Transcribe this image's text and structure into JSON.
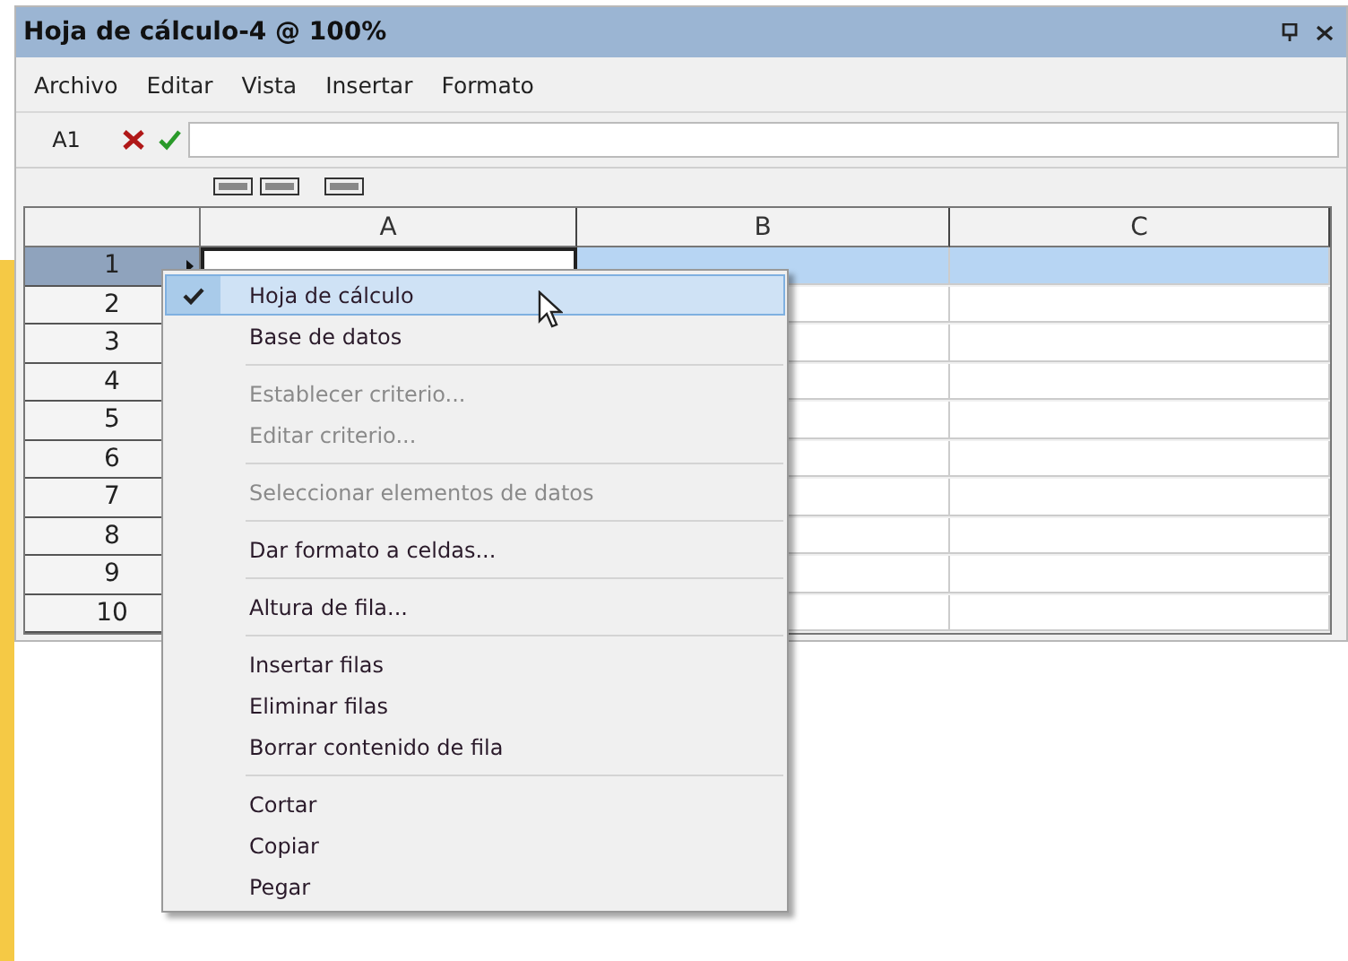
{
  "window": {
    "title": "Hoja de cálculo-4 @ 100%",
    "controls": [
      {
        "kind": "pin"
      },
      {
        "kind": "close"
      }
    ]
  },
  "menu_bar": [
    "Archivo",
    "Editar",
    "Vista",
    "Insertar",
    "Formato"
  ],
  "formula_bar": {
    "cell_ref": "A1"
  },
  "grid": {
    "columns": [
      "A",
      "B",
      "C"
    ],
    "rows": [
      {
        "label": "1",
        "selected": true
      },
      {
        "label": "2",
        "selected": false
      },
      {
        "label": "3",
        "selected": false
      },
      {
        "label": "4",
        "selected": false
      },
      {
        "label": "5",
        "selected": false
      },
      {
        "label": "6",
        "selected": false
      },
      {
        "label": "7",
        "selected": false
      },
      {
        "label": "8",
        "selected": false
      },
      {
        "label": "9",
        "selected": false
      },
      {
        "label": "10",
        "selected": false
      }
    ]
  },
  "context_menu": [
    {
      "kind": "item",
      "label": "Hoja de cálculo",
      "checked": true,
      "disabled": false,
      "selected": true
    },
    {
      "kind": "item",
      "label": "Base de datos",
      "checked": false,
      "disabled": false,
      "selected": false
    },
    {
      "kind": "separator"
    },
    {
      "kind": "item",
      "label": "Establecer criterio...",
      "checked": false,
      "disabled": true,
      "selected": false
    },
    {
      "kind": "item",
      "label": "Editar criterio...",
      "checked": false,
      "disabled": true,
      "selected": false
    },
    {
      "kind": "separator"
    },
    {
      "kind": "item",
      "label": "Seleccionar elementos de datos",
      "checked": false,
      "disabled": true,
      "selected": false
    },
    {
      "kind": "separator"
    },
    {
      "kind": "item",
      "label": "Dar formato a celdas...",
      "checked": false,
      "disabled": false,
      "selected": false
    },
    {
      "kind": "separator"
    },
    {
      "kind": "item",
      "label": "Altura de fila...",
      "checked": false,
      "disabled": false,
      "selected": false
    },
    {
      "kind": "separator"
    },
    {
      "kind": "item",
      "label": "Insertar filas",
      "checked": false,
      "disabled": false,
      "selected": false
    },
    {
      "kind": "item",
      "label": "Eliminar filas",
      "checked": false,
      "disabled": false,
      "selected": false
    },
    {
      "kind": "item",
      "label": "Borrar contenido de fila",
      "checked": false,
      "disabled": false,
      "selected": false
    },
    {
      "kind": "separator"
    },
    {
      "kind": "item",
      "label": "Cortar",
      "checked": false,
      "disabled": false,
      "selected": false
    },
    {
      "kind": "item",
      "label": "Copiar",
      "checked": false,
      "disabled": false,
      "selected": false
    },
    {
      "kind": "item",
      "label": "Pegar",
      "checked": false,
      "disabled": false,
      "selected": false
    }
  ]
}
